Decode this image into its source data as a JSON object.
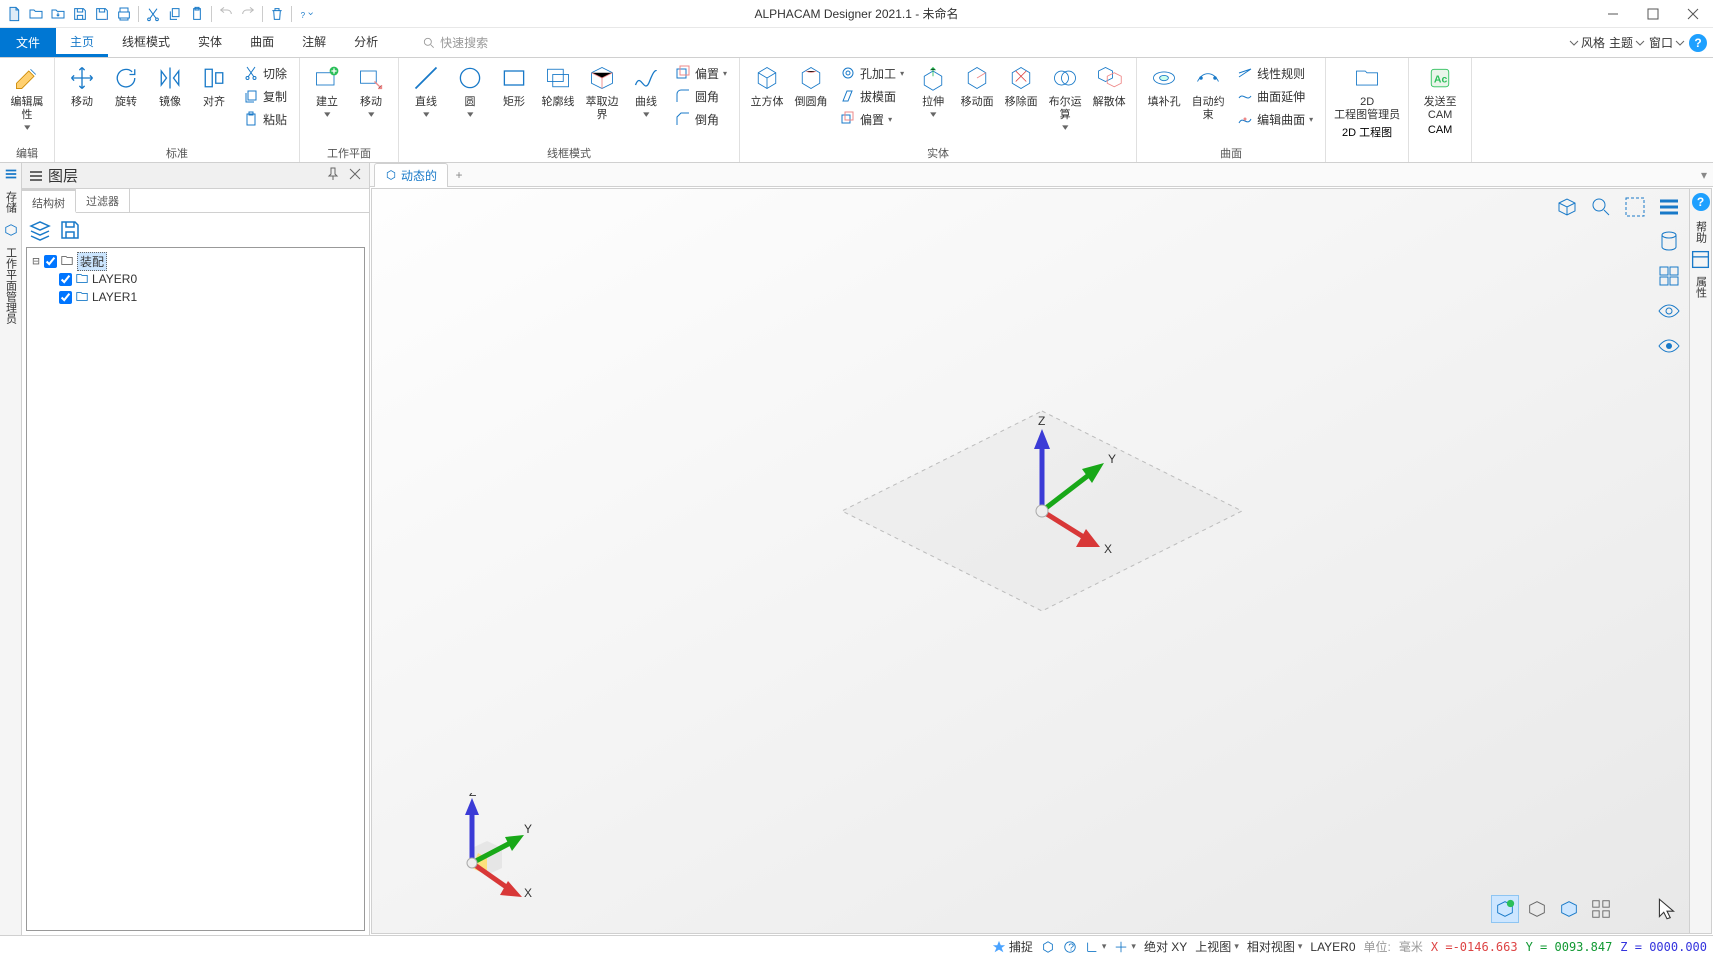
{
  "app": {
    "title": "ALPHACAM Designer 2021.1 - 未命名"
  },
  "menu": {
    "file": "文件",
    "tabs": [
      "主页",
      "线框模式",
      "实体",
      "曲面",
      "注解",
      "分析"
    ],
    "active": 0,
    "search_hint": "快速搜索",
    "right": {
      "style": "风格",
      "theme": "主题",
      "window": "窗口"
    }
  },
  "ribbon": {
    "groups": [
      {
        "label": "编辑",
        "big": [
          {
            "key": "edit-attrs",
            "lbl": "编辑属性"
          }
        ]
      },
      {
        "label": "标准",
        "big": [
          {
            "key": "move",
            "lbl": "移动"
          },
          {
            "key": "rotate",
            "lbl": "旋转"
          },
          {
            "key": "mirror",
            "lbl": "镜像"
          },
          {
            "key": "align",
            "lbl": "对齐"
          }
        ],
        "small": [
          {
            "key": "cut",
            "lbl": "切除"
          },
          {
            "key": "copy",
            "lbl": "复制"
          },
          {
            "key": "paste",
            "lbl": "粘贴"
          }
        ]
      },
      {
        "label": "工作平面",
        "big": [
          {
            "key": "create",
            "lbl": "建立"
          },
          {
            "key": "wp-move",
            "lbl": "移动"
          }
        ]
      },
      {
        "label": "线框模式",
        "big": [
          {
            "key": "line",
            "lbl": "直线"
          },
          {
            "key": "circle",
            "lbl": "圆"
          },
          {
            "key": "rect",
            "lbl": "矩形"
          },
          {
            "key": "contour",
            "lbl": "轮廓线"
          },
          {
            "key": "extract",
            "lbl": "萃取边界"
          },
          {
            "key": "curve",
            "lbl": "曲线"
          }
        ],
        "small": [
          {
            "key": "offset",
            "lbl": "偏置"
          },
          {
            "key": "fillet",
            "lbl": "圆角"
          },
          {
            "key": "chamfer",
            "lbl": "倒角"
          }
        ]
      },
      {
        "label": "实体",
        "big": [
          {
            "key": "cube",
            "lbl": "立方体"
          },
          {
            "key": "round",
            "lbl": "倒圆角"
          }
        ],
        "small": [
          {
            "key": "hole",
            "lbl": "孔加工"
          },
          {
            "key": "extrude",
            "lbl": "拔模面"
          },
          {
            "key": "soffset",
            "lbl": "偏置"
          }
        ],
        "big2": [
          {
            "key": "pull",
            "lbl": "拉伸"
          },
          {
            "key": "moveface",
            "lbl": "移动面"
          },
          {
            "key": "removeface",
            "lbl": "移除面"
          },
          {
            "key": "boolean",
            "lbl": "布尔运算"
          },
          {
            "key": "dissolve",
            "lbl": "解散体"
          }
        ]
      },
      {
        "label": "曲面",
        "big": [
          {
            "key": "fillhole",
            "lbl": "填补孔"
          },
          {
            "key": "autoconstrain",
            "lbl": "自动约束"
          }
        ],
        "small": [
          {
            "key": "linerule",
            "lbl": "线性规则"
          },
          {
            "key": "surfext",
            "lbl": "曲面延伸"
          },
          {
            "key": "editcurve",
            "lbl": "编辑曲面"
          }
        ]
      },
      {
        "label": "",
        "big": [
          {
            "key": "drawing-mgr",
            "lbl": "2D\n工程图管理员"
          },
          {
            "key": "drawing-2d",
            "lbl": "2D 工程图"
          }
        ]
      },
      {
        "label": "",
        "big": [
          {
            "key": "send-cam",
            "lbl": "发送至\nCAM"
          },
          {
            "key": "cam",
            "lbl": "CAM"
          }
        ]
      }
    ]
  },
  "left_rail": [
    "存储",
    "工作平面管理员"
  ],
  "panel": {
    "title": "图层",
    "tabs": [
      "结构树",
      "过滤器"
    ],
    "active": 0,
    "tree": {
      "root": "装配",
      "children": [
        "LAYER0",
        "LAYER1"
      ]
    }
  },
  "viewport": {
    "tab": "动态的"
  },
  "right_rail": [
    "帮助",
    "属性"
  ],
  "status": {
    "snap": "捕捉",
    "abs": "绝对 XY",
    "topview": "上视图",
    "relview": "相对视图",
    "layer": "LAYER0",
    "units_label": "单位:",
    "units": "毫米",
    "x": "X =-0146.663",
    "y": "Y = 0093.847",
    "z": "Z = 0000.000"
  }
}
